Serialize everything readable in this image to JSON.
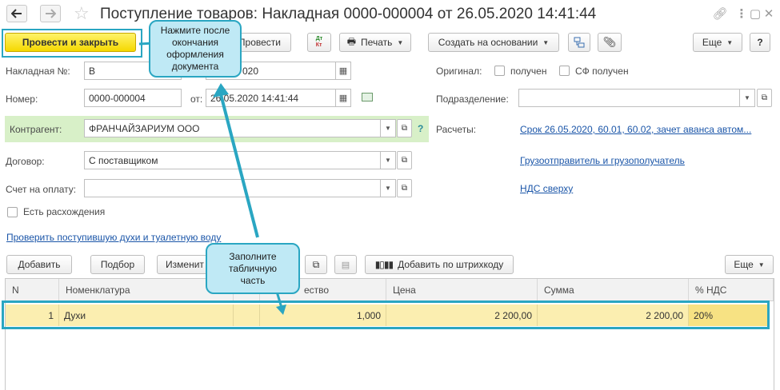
{
  "title": "Поступление товаров: Накладная 0000-000004 от 26.05.2020 14:41:44",
  "toolbar": {
    "post_close": "Провести и закрыть",
    "post": "Провести",
    "print": "Печать",
    "create_based": "Создать на основании",
    "more": "Еще",
    "help": "?"
  },
  "form": {
    "invoice_label": "Накладная №:",
    "invoice_value": "В",
    "invoice_date_value": "020",
    "number_label": "Номер:",
    "number_value": "0000-000004",
    "from_label": "от:",
    "date_value": "26.05.2020 14:41:44",
    "counterparty_label": "Контрагент:",
    "counterparty_value": "ФРАНЧАЙЗАРИУМ ООО",
    "contract_label": "Договор:",
    "contract_value": "С поставщиком",
    "payment_label": "Счет на оплату:",
    "payment_value": "",
    "discrepancy_label": "Есть расхождения",
    "check_link": "Проверить поступившую духи и туалетную воду",
    "original_label": "Оригинал:",
    "received_label": "получен",
    "sf_received_label": "СФ получен",
    "department_label": "Подразделение:",
    "department_value": "",
    "settlements_label": "Расчеты:",
    "settlements_link": "Срок 26.05.2020, 60.01, 60.02, зачет аванса автом...",
    "shipper_link": "Грузоотправитель и грузополучатель",
    "vat_link": "НДС сверху",
    "question": "?"
  },
  "table_toolbar": {
    "add": "Добавить",
    "pick": "Подбор",
    "change": "Изменит",
    "barcode": "Добавить по штрихкоду",
    "more": "Еще"
  },
  "table": {
    "headers": [
      "N",
      "Номенклатура",
      "",
      "ество",
      "Цена",
      "Сумма",
      "% НДС"
    ],
    "rows": [
      {
        "n": "1",
        "item": "Духи",
        "qty": "1,000",
        "price": "2 200,00",
        "sum": "2 200,00",
        "vat": "20%"
      }
    ]
  },
  "callouts": {
    "top": "Нажмите после окончания оформления документа",
    "bottom": "Заполните табличную часть"
  },
  "colors": {
    "accent": "#2aa6c2",
    "callout_bg": "#bfe9f5",
    "primary_button": "#f5d800",
    "selected_row": "#fbeeb0",
    "link": "#1a55a8",
    "counterparty_bg": "#d8f0c8"
  }
}
